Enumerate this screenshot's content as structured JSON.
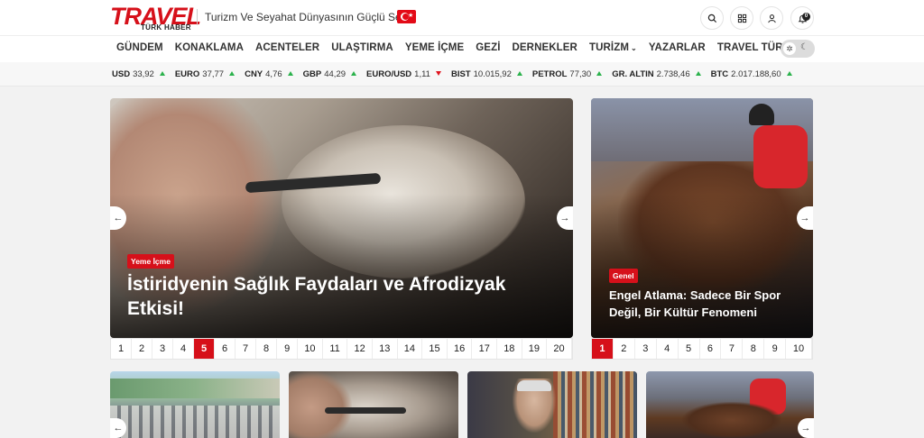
{
  "header": {
    "logo_text": "TRAVEL",
    "logo_sub": "TÜRK HABER",
    "tagline": "Turizm Ve Seyahat Dünyasının Güçlü Sesi",
    "notification_count": "0"
  },
  "nav": {
    "items": [
      "GÜNDEM",
      "KONAKLAMA",
      "ACENTELER",
      "ULAŞTIRMA",
      "YEME İÇME",
      "GEZİ",
      "DERNEKLER",
      "TURİZM",
      "YAZARLAR",
      "TRAVEL TÜRK TV"
    ]
  },
  "ticker": [
    {
      "name": "USD",
      "value": "33,92",
      "dir": "up"
    },
    {
      "name": "EURO",
      "value": "37,77",
      "dir": "up"
    },
    {
      "name": "CNY",
      "value": "4,76",
      "dir": "up"
    },
    {
      "name": "GBP",
      "value": "44,29",
      "dir": "up"
    },
    {
      "name": "EURO/USD",
      "value": "1,11",
      "dir": "down"
    },
    {
      "name": "BIST",
      "value": "10.015,92",
      "dir": "up"
    },
    {
      "name": "PETROL",
      "value": "77,30",
      "dir": "up"
    },
    {
      "name": "GR. ALTIN",
      "value": "2.738,46",
      "dir": "up"
    },
    {
      "name": "BTC",
      "value": "2.017.188,60",
      "dir": "up"
    }
  ],
  "main_slider": {
    "category": "Yeme İçme",
    "title_line1": "İstiridyenin Sağlık Faydaları ve Afrodizyak",
    "title_line2": "Etkisi!",
    "pages": [
      "1",
      "2",
      "3",
      "4",
      "5",
      "6",
      "7",
      "8",
      "9",
      "10",
      "11",
      "12",
      "13",
      "14",
      "15",
      "16",
      "17",
      "18",
      "19",
      "20"
    ],
    "active_page": "5"
  },
  "side_slider": {
    "category": "Genel",
    "title_line1": "Engel Atlama: Sadece Bir Spor",
    "title_line2": "Değil, Bir Kültür Fenomeni",
    "pages": [
      "1",
      "2",
      "3",
      "4",
      "5",
      "6",
      "7",
      "8",
      "9",
      "10"
    ],
    "active_page": "1"
  },
  "colors": {
    "accent": "#d6101a",
    "up": "#2bb24c",
    "down": "#e0141e"
  }
}
